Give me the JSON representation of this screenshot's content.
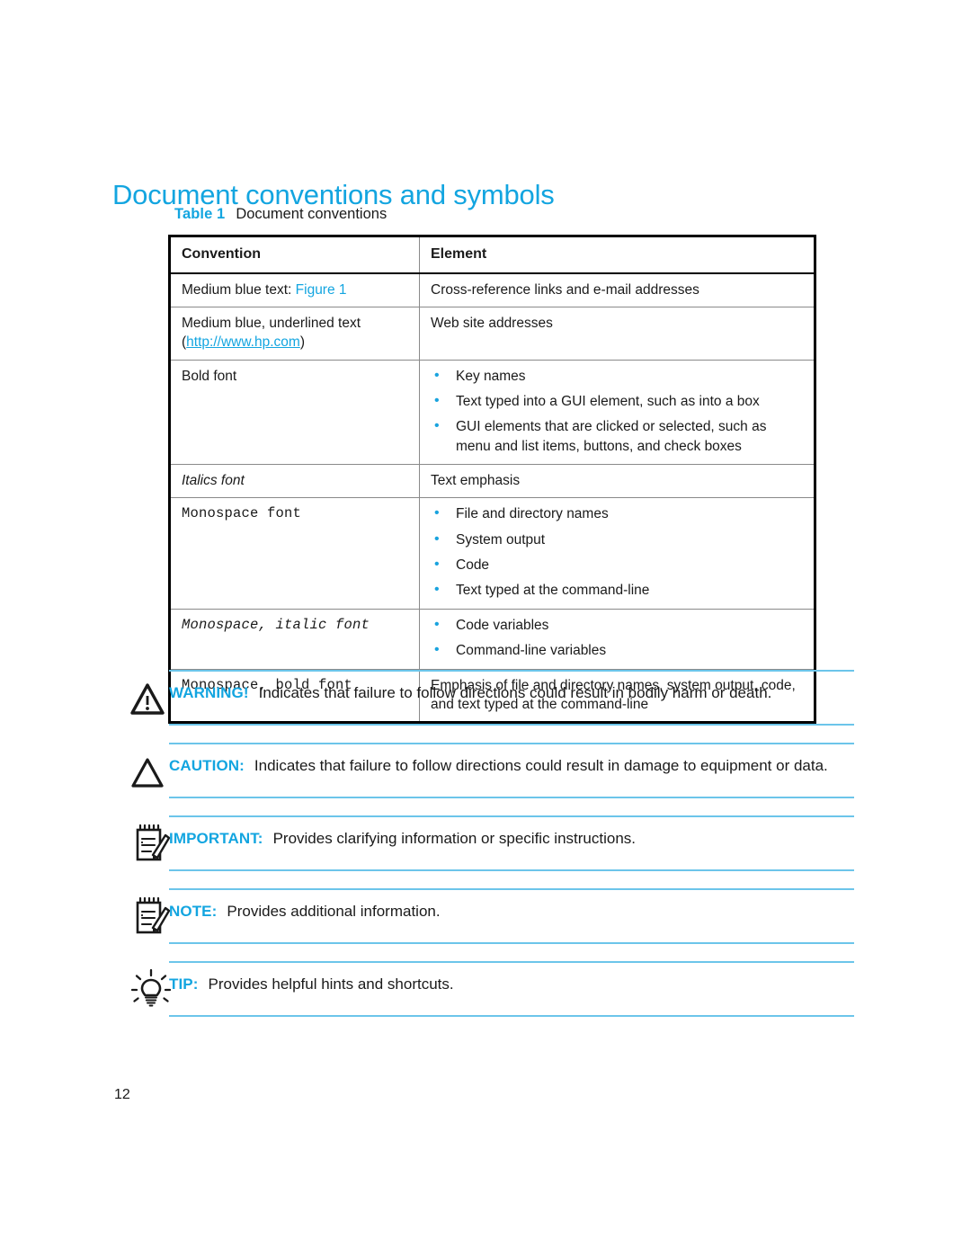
{
  "page": {
    "title": "Document conventions and symbols",
    "number": "12",
    "accent_color": "#13a5e0",
    "rule_color": "#6cc5ea",
    "bullet_color": "#19a3de"
  },
  "table": {
    "caption_label": "Table 1",
    "caption_text": "Document conventions",
    "headers": [
      "Convention",
      "Element"
    ],
    "rows": [
      {
        "convention_prefix": "Medium blue text: ",
        "convention_accent": "Figure 1",
        "element_text": "Cross-reference links and e-mail addresses"
      },
      {
        "convention_line1": "Medium blue, underlined text",
        "convention_paren_open": "(",
        "convention_link": "http://www.hp.com",
        "convention_paren_close": ")",
        "element_text": "Web site addresses"
      },
      {
        "convention_text": "Bold font",
        "element_bullets": [
          "Key names",
          "Text typed into a GUI element, such as into a box",
          "GUI elements that are clicked or selected, such as menu and list items, buttons, and check boxes"
        ]
      },
      {
        "convention_text": "Italics font",
        "element_text": "Text emphasis"
      },
      {
        "convention_text": "Monospace font",
        "element_bullets": [
          "File and directory names",
          "System output",
          "Code",
          "Text typed at the command-line"
        ]
      },
      {
        "convention_text": "Monospace, italic font",
        "element_bullets": [
          "Code variables",
          "Command-line variables"
        ]
      },
      {
        "convention_text": "Monospace, bold font",
        "element_text": "Emphasis of file and directory names, system output, code, and text typed at the command-line"
      }
    ]
  },
  "notices": [
    {
      "icon": "warning-triangle-icon",
      "keyword": "WARNING!",
      "description": "Indicates that failure to follow directions could result in bodily harm or death."
    },
    {
      "icon": "caution-triangle-icon",
      "keyword": "CAUTION:",
      "description": "Indicates that failure to follow directions could result in damage to equipment or data."
    },
    {
      "icon": "notepad-pencil-icon",
      "keyword": "IMPORTANT:",
      "description": "Provides clarifying information or specific instructions."
    },
    {
      "icon": "notepad-pencil-icon",
      "keyword": "NOTE:",
      "description": "Provides additional information."
    },
    {
      "icon": "lightbulb-icon",
      "keyword": "TIP:",
      "description": "Provides helpful hints and shortcuts."
    }
  ]
}
